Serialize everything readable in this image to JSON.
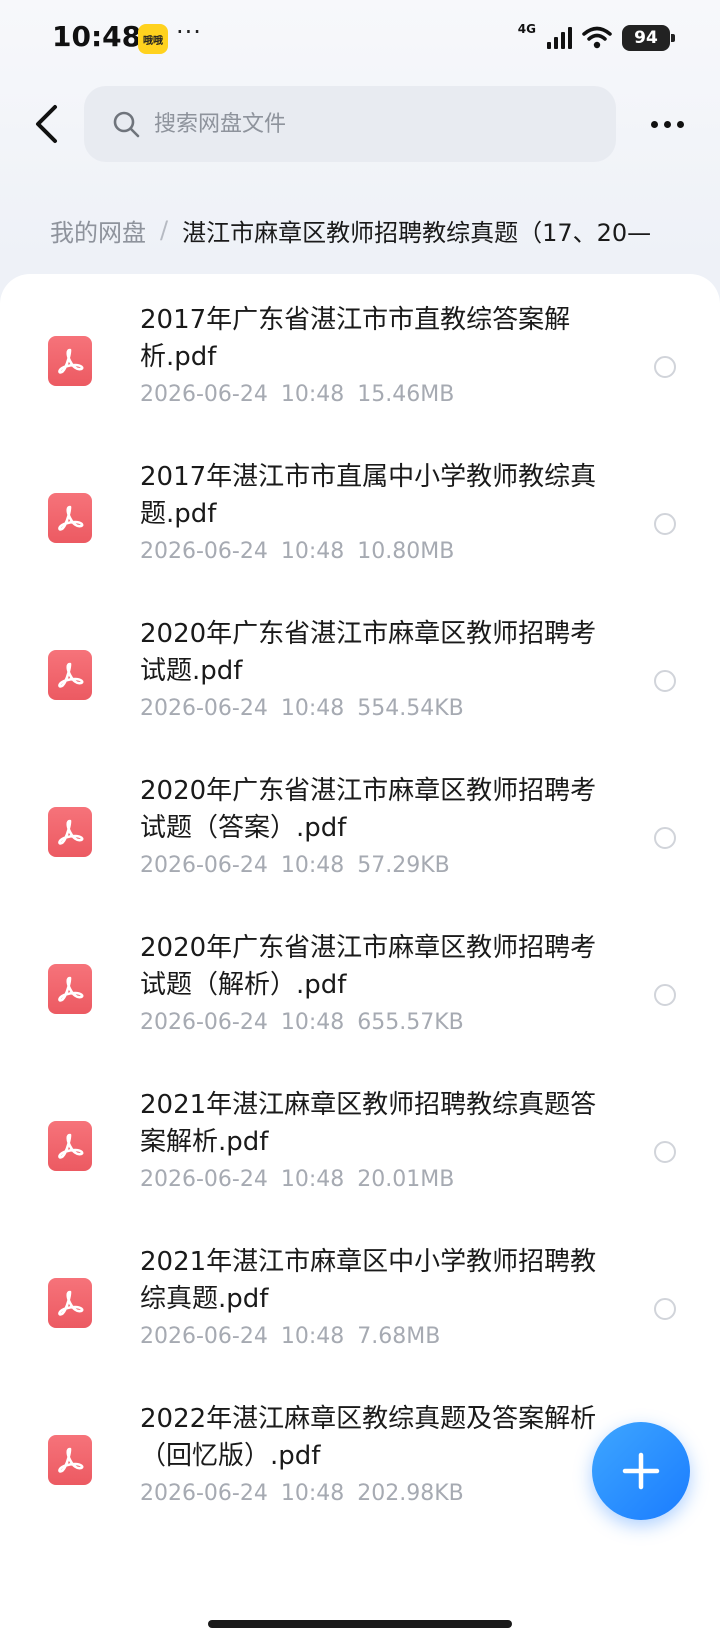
{
  "status_bar": {
    "time": "10:48",
    "app_icon_text": "哦哦",
    "more_dots": "···",
    "network": "4G",
    "battery": "94"
  },
  "header": {
    "search_placeholder": "搜索网盘文件"
  },
  "breadcrumb": {
    "root": "我的网盘",
    "separator": "/",
    "current": "湛江市麻章区教师招聘教综真题（17、20—"
  },
  "files": [
    {
      "name": "2017年广东省湛江市市直教综答案解析.pdf",
      "date": "2026-06-24",
      "time": "10:48",
      "size": "15.46MB"
    },
    {
      "name": "2017年湛江市市直属中小学教师教综真题.pdf",
      "date": "2026-06-24",
      "time": "10:48",
      "size": "10.80MB"
    },
    {
      "name": "2020年广东省湛江市麻章区教师招聘考试题.pdf",
      "date": "2026-06-24",
      "time": "10:48",
      "size": "554.54KB"
    },
    {
      "name": "2020年广东省湛江市麻章区教师招聘考试题（答案）.pdf",
      "date": "2026-06-24",
      "time": "10:48",
      "size": "57.29KB"
    },
    {
      "name": "2020年广东省湛江市麻章区教师招聘考试题（解析）.pdf",
      "date": "2026-06-24",
      "time": "10:48",
      "size": "655.57KB"
    },
    {
      "name": "2021年湛江麻章区教师招聘教综真题答案解析.pdf",
      "date": "2026-06-24",
      "time": "10:48",
      "size": "20.01MB"
    },
    {
      "name": "2021年湛江市麻章区中小学教师招聘教综真题.pdf",
      "date": "2026-06-24",
      "time": "10:48",
      "size": "7.68MB"
    },
    {
      "name": "2022年湛江麻章区教综真题及答案解析（回忆版）.pdf",
      "date": "2026-06-24",
      "time": "10:48",
      "size": "202.98KB"
    }
  ],
  "icons": {
    "back": "chevron-left-icon",
    "search": "search-icon",
    "more": "more-horizontal-icon",
    "file": "pdf-icon",
    "fab": "plus-icon"
  },
  "colors": {
    "pdf_icon": "#ec5a62",
    "fab": "#1a7cff",
    "meta_text": "#a6aab2"
  }
}
